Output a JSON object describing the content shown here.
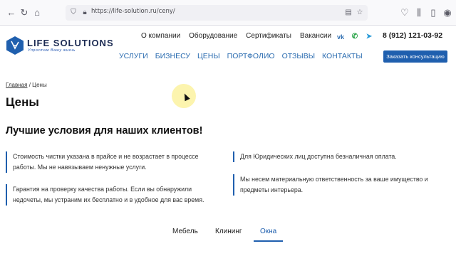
{
  "browser": {
    "url": "https://life-solution.ru/ceny/",
    "icons": [
      "back-icon",
      "forward-icon",
      "reload-icon",
      "home-icon",
      "shield-icon",
      "lock-icon",
      "reader-icon",
      "star-icon",
      "pocket-icon",
      "library-icon",
      "sidebar-icon",
      "profile-icon"
    ]
  },
  "header": {
    "logo_title": "LIFE SOLUTIONS",
    "logo_subtitle": "Упростим Вашу жизнь",
    "top_menu": [
      "О компании",
      "Оборудование",
      "Сертификаты",
      "Вакансии"
    ],
    "main_menu": [
      "Услуги",
      "Бизнесу",
      "Цены",
      "Портфолио",
      "Отзывы",
      "Контакты"
    ],
    "phone": "8 (912) 121-03-92",
    "cta_label": "Заказать консультацию",
    "social_icons": [
      "vk-icon",
      "whatsapp-icon",
      "telegram-icon"
    ],
    "brand_color": "#1f5fae"
  },
  "breadcrumb": {
    "home": "Главная",
    "separator": "/",
    "current": "Цены"
  },
  "page": {
    "title": "Цены",
    "subheading": "Лучшие условия для наших клиентов!",
    "features": [
      "Стоимость чистки указана в прайсе и не возрастает в процессе работы. Мы не навязываем ненужные услуги.",
      "Гарантия на проверку качества работы. Если вы обнаружили недочеты, мы устраним их бесплатно и в удобное для вас время.",
      "Для Юридических лиц доступна безналичная оплата.",
      "Мы несем материальную ответственность за ваше имущество и предметы интерьера."
    ],
    "tabs": [
      "Мебель",
      "Клининг",
      "Окна"
    ],
    "active_tab": "Окна"
  }
}
